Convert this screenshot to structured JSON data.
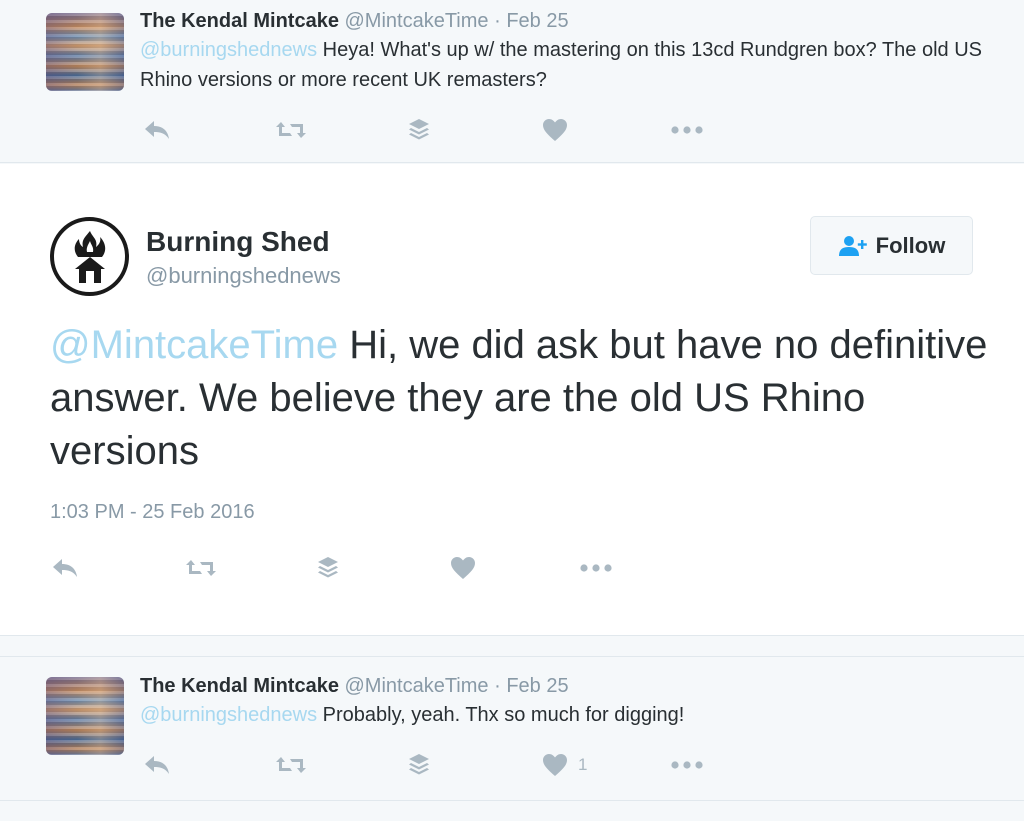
{
  "reply_top": {
    "name": "The Kendal Mintcake",
    "handle": "@MintcakeTime",
    "separator": "·",
    "date": "Feb 25",
    "mention": "@burningshednews",
    "text": " Heya! What's up w/ the mastering on this 13cd Rundgren box? The old US Rhino versions or more recent UK remasters?",
    "actions": [
      "reply-icon",
      "retweet-icon",
      "buffer-icon",
      "heart-icon",
      "more-icon"
    ]
  },
  "main_tweet": {
    "name": "Burning Shed",
    "handle": "@burningshednews",
    "follow_label": "Follow",
    "mention": "@MintcakeTime",
    "text": " Hi, we did ask but have no definitive answer. We believe they are the old US Rhino versions",
    "timestamp": "1:03 PM - 25 Feb 2016",
    "actions": [
      "reply-icon",
      "retweet-icon",
      "buffer-icon",
      "heart-icon",
      "more-icon"
    ]
  },
  "reply_bottom": {
    "name": "The Kendal Mintcake",
    "handle": "@MintcakeTime",
    "separator": "·",
    "date": "Feb 25",
    "mention": "@burningshednews",
    "text": " Probably, yeah. Thx so much for digging!",
    "like_count": "1",
    "actions": [
      "reply-icon",
      "retweet-icon",
      "buffer-icon",
      "heart-icon",
      "more-icon"
    ]
  },
  "colors": {
    "mention": "#a7d8f0",
    "muted": "#8899a6",
    "icon": "#aab8c2",
    "text": "#292f33",
    "background": "#f5f8fa"
  }
}
